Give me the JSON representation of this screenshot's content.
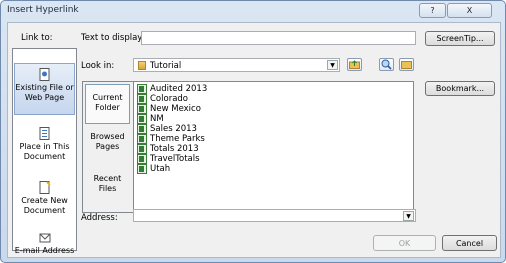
{
  "window": {
    "title": "Insert Hyperlink",
    "help_glyph": "?",
    "close_glyph": "X"
  },
  "link_to": {
    "label": "Link to:",
    "items": [
      {
        "label1": "Existing File or",
        "label2": "Web Page",
        "icon": "web-page-icon"
      },
      {
        "label1": "Place in This",
        "label2": "Document",
        "icon": "document-place-icon"
      },
      {
        "label1": "Create New",
        "label2": "Document",
        "icon": "new-document-icon"
      },
      {
        "label1": "E-mail Address",
        "label2": "",
        "icon": "email-icon"
      }
    ]
  },
  "text_to_display": {
    "label": "Text to display:",
    "value": ""
  },
  "screentip_button": "ScreenTip...",
  "look_in": {
    "label": "Look in:",
    "value": "Tutorial"
  },
  "bookmark_button": "Bookmark...",
  "nav_buttons": [
    {
      "label1": "Current",
      "label2": "Folder"
    },
    {
      "label1": "Browsed",
      "label2": "Pages"
    },
    {
      "label1": "Recent",
      "label2": "Files"
    }
  ],
  "files": [
    "Audited 2013",
    "Colorado",
    "New Mexico",
    "NM",
    "Sales 2013",
    "Theme Parks",
    "Totals 2013",
    "TravelTotals",
    "Utah"
  ],
  "address": {
    "label": "Address:",
    "value": ""
  },
  "ok_button": "OK",
  "cancel_button": "Cancel"
}
